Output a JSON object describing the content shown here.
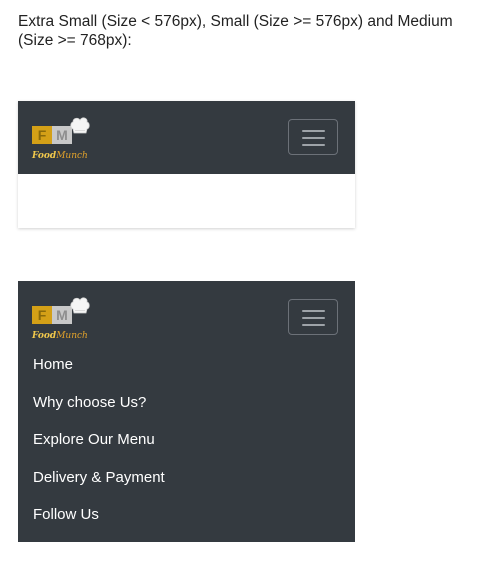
{
  "intro_text": "Extra Small (Size < 576px), Small (Size >= 576px) and Medium (Size >= 768px):",
  "brand": {
    "logo_letter_1": "F",
    "logo_letter_2": "M",
    "name_part_1": "Food",
    "name_part_2": "Munch",
    "icon": "chef-hat-icon",
    "colors": {
      "logo_f_bg": "#d4a017",
      "logo_m_bg": "#c8c8c8",
      "name_text": "#f2c94c"
    }
  },
  "navbar": {
    "background": "#343a40",
    "toggler_icon": "hamburger-menu-icon",
    "items": [
      {
        "label": "Home"
      },
      {
        "label": "Why choose Us?"
      },
      {
        "label": "Explore Our Menu"
      },
      {
        "label": "Delivery & Payment"
      },
      {
        "label": "Follow Us"
      }
    ]
  }
}
